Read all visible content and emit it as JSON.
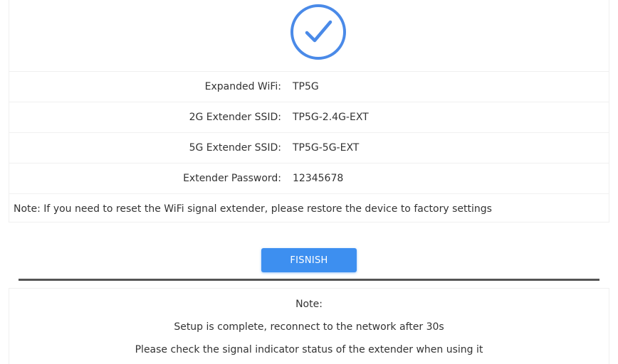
{
  "status": {
    "icon": "check-circle-icon",
    "accent_color": "#4a8ae8"
  },
  "info": [
    {
      "label": "Expanded WiFi:",
      "value": "TP5G"
    },
    {
      "label": "2G Extender SSID:",
      "value": "TP5G-2.4G-EXT"
    },
    {
      "label": "5G Extender SSID:",
      "value": "TP5G-5G-EXT"
    },
    {
      "label": "Extender Password:",
      "value": "12345678"
    }
  ],
  "reset_note": "Note: If you need to reset the WiFi signal extender, please restore the device to factory settings",
  "finish_button": {
    "label": "FISNISH",
    "color": "#3d8ff0"
  },
  "bottom_note": {
    "title": "Note:",
    "line1": "Setup is complete, reconnect to the network after 30s",
    "line2": "Please check the signal indicator status of the extender when using it"
  }
}
